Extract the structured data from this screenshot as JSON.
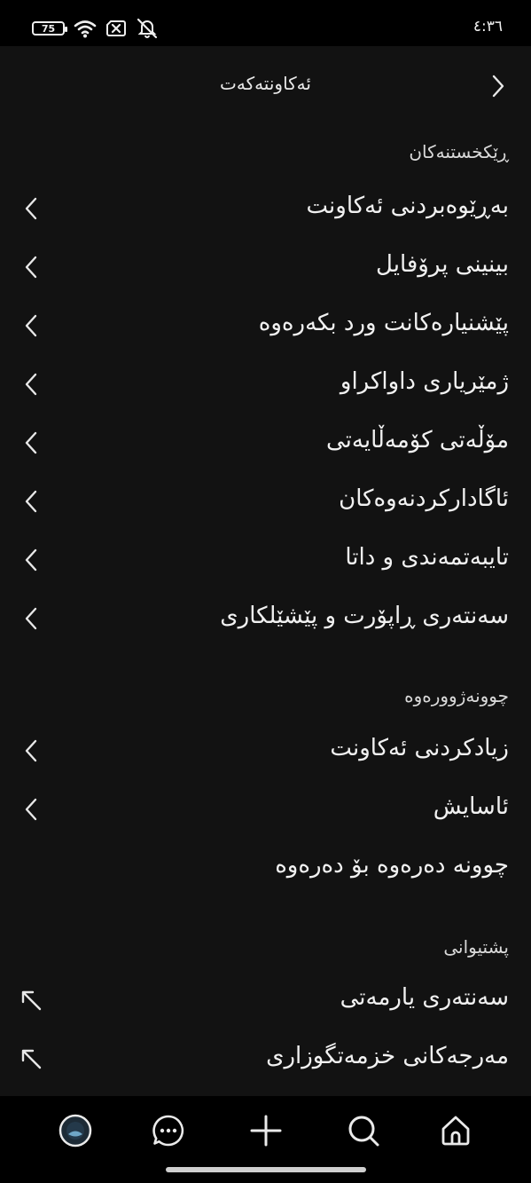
{
  "status_bar": {
    "battery_level": "75",
    "time": "٤:٣٦",
    "icons": [
      "battery-icon",
      "wifi-icon",
      "sim-off-icon",
      "notifications-off-icon"
    ]
  },
  "header": {
    "title": "ئەکاونتەکەت",
    "back_icon": "chevron-right-icon"
  },
  "sections": [
    {
      "title": "ڕێکخستنەکان",
      "items": [
        {
          "label": "بەڕێوەبردنی ئەکاونت",
          "icon": "chevron-left-icon"
        },
        {
          "label": "بینینی پرۆفایل",
          "icon": "chevron-left-icon"
        },
        {
          "label": "پێشنیارەکانت ورد بکەرەوە",
          "icon": "chevron-left-icon"
        },
        {
          "label": "ژمێریاری داواکراو",
          "icon": "chevron-left-icon"
        },
        {
          "label": "مۆڵەتی کۆمەڵایەتی",
          "icon": "chevron-left-icon"
        },
        {
          "label": "ئاگادارکردنەوەکان",
          "icon": "chevron-left-icon"
        },
        {
          "label": "تایبەتمەندی و داتا",
          "icon": "chevron-left-icon"
        },
        {
          "label": "سەنتەری ڕاپۆرت و پێشێلکاری",
          "icon": "chevron-left-icon"
        }
      ]
    },
    {
      "title": "چوونەژوورەوە",
      "items": [
        {
          "label": "زیادکردنی ئەکاونت",
          "icon": "chevron-left-icon"
        },
        {
          "label": "ئاسایش",
          "icon": "chevron-left-icon"
        },
        {
          "label": "چوونە دەرەوە بۆ دەرەوە",
          "icon": ""
        }
      ]
    },
    {
      "title": "پشتیوانی",
      "items": [
        {
          "label": "سەنتەری یارمەتی",
          "icon": "external-link-icon"
        },
        {
          "label": "مەرجەکانی خزمەتگوزاری",
          "icon": "external-link-icon"
        }
      ]
    }
  ],
  "bottom_nav": {
    "items": [
      "profile-avatar-icon",
      "messages-icon",
      "create-plus-icon",
      "search-icon",
      "home-icon"
    ]
  },
  "colors": {
    "app_background": "#121212",
    "bars_background": "#000000",
    "text": "#f1f1f1"
  }
}
